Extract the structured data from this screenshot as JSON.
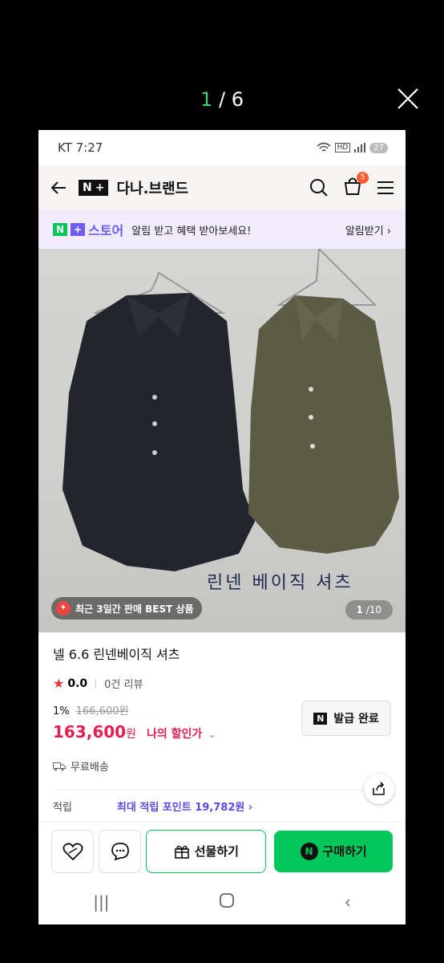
{
  "viewer": {
    "current": "1",
    "separator": "/",
    "total": "6"
  },
  "status": {
    "carrier_time": "KT 7:27",
    "battery": "27"
  },
  "header": {
    "brand": "다나.브랜드",
    "cart_count": "5"
  },
  "banner": {
    "logo_n": "N",
    "logo_plus": "+",
    "store": "스토어",
    "text": "알림 받고 혜택 받아보세요!",
    "action": "알림받기 ›"
  },
  "photo": {
    "caption": "린넨 베이직 셔츠",
    "best_label": "최근 3일간 판매 BEST 상품",
    "page_current": "1",
    "page_total": "/10"
  },
  "product": {
    "title": "넬 6.6 린넨베이직 셔츠",
    "rating": "0.0",
    "reviews": "0건 리뷰",
    "discount_rate": "1%",
    "original_price": "166,600원",
    "price": "163,600",
    "price_unit": "원",
    "my_discount": "나의 할인가",
    "coupon_label": "발급 완료",
    "shipping": "무료배송",
    "points_label": "적립",
    "points_value": "최대 적립 포인트 19,782원 ›"
  },
  "actions": {
    "gift": "선물하기",
    "buy": "구매하기"
  },
  "colors": {
    "naver_green": "#03c75a",
    "price_red": "#e61e4d",
    "accent_purple": "#6f5cf0"
  }
}
